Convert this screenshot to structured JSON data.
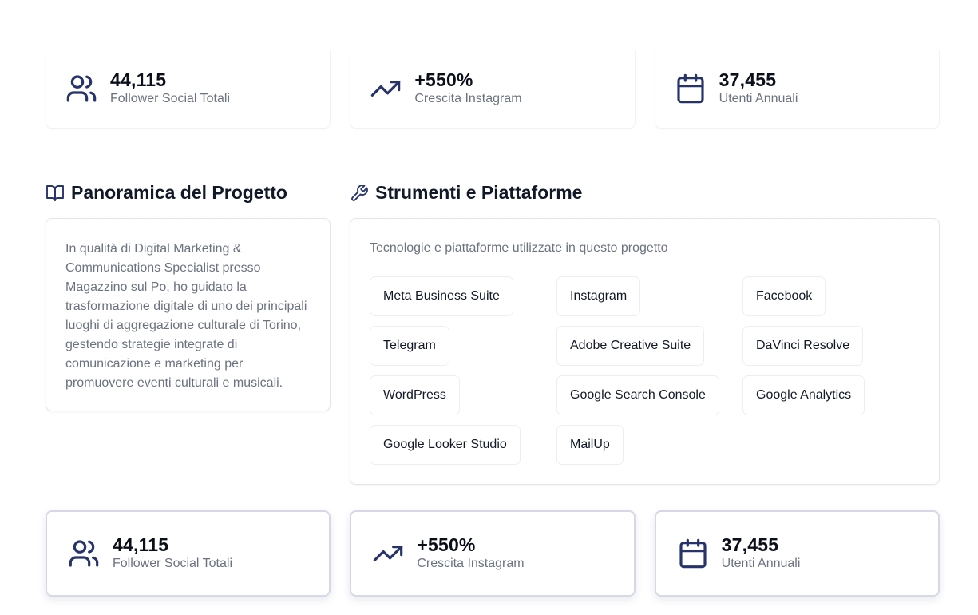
{
  "stats_top": [
    {
      "icon": "users-icon",
      "value": "44,115",
      "label": "Follower Social Totali"
    },
    {
      "icon": "trending-up-icon",
      "value": "+550%",
      "label": "Crescita Instagram"
    },
    {
      "icon": "calendar-icon",
      "value": "37,455",
      "label": "Utenti Annuali"
    }
  ],
  "overview": {
    "title": "Panoramica del Progetto",
    "icon": "book-open-icon",
    "text": "In qualità di Digital Marketing & Communications Specialist presso Magazzino sul Po, ho guidato la trasformazione digitale di uno dei principali luoghi di aggregazione culturale di Torino, gestendo strategie integrate di comunicazione e marketing per promuovere eventi culturali e musicali."
  },
  "tools": {
    "title": "Strumenti e Piattaforme",
    "icon": "wrench-icon",
    "description": "Tecnologie e piattaforme utilizzate in questo progetto",
    "items": [
      "Meta Business Suite",
      "Instagram",
      "Facebook",
      "Telegram",
      "Adobe Creative Suite",
      "DaVinci Resolve",
      "WordPress",
      "Google Search Console",
      "Google Analytics",
      "Google Looker Studio",
      "MailUp"
    ]
  },
  "stats_bottom": [
    {
      "icon": "users-icon",
      "value": "44,115",
      "label": "Follower Social Totali"
    },
    {
      "icon": "trending-up-icon",
      "value": "+550%",
      "label": "Crescita Instagram"
    },
    {
      "icon": "calendar-icon",
      "value": "37,455",
      "label": "Utenti Annuali"
    }
  ],
  "colors": {
    "accent": "#27336b",
    "muted_text": "#6b7280",
    "border": "#e3e5ea"
  }
}
